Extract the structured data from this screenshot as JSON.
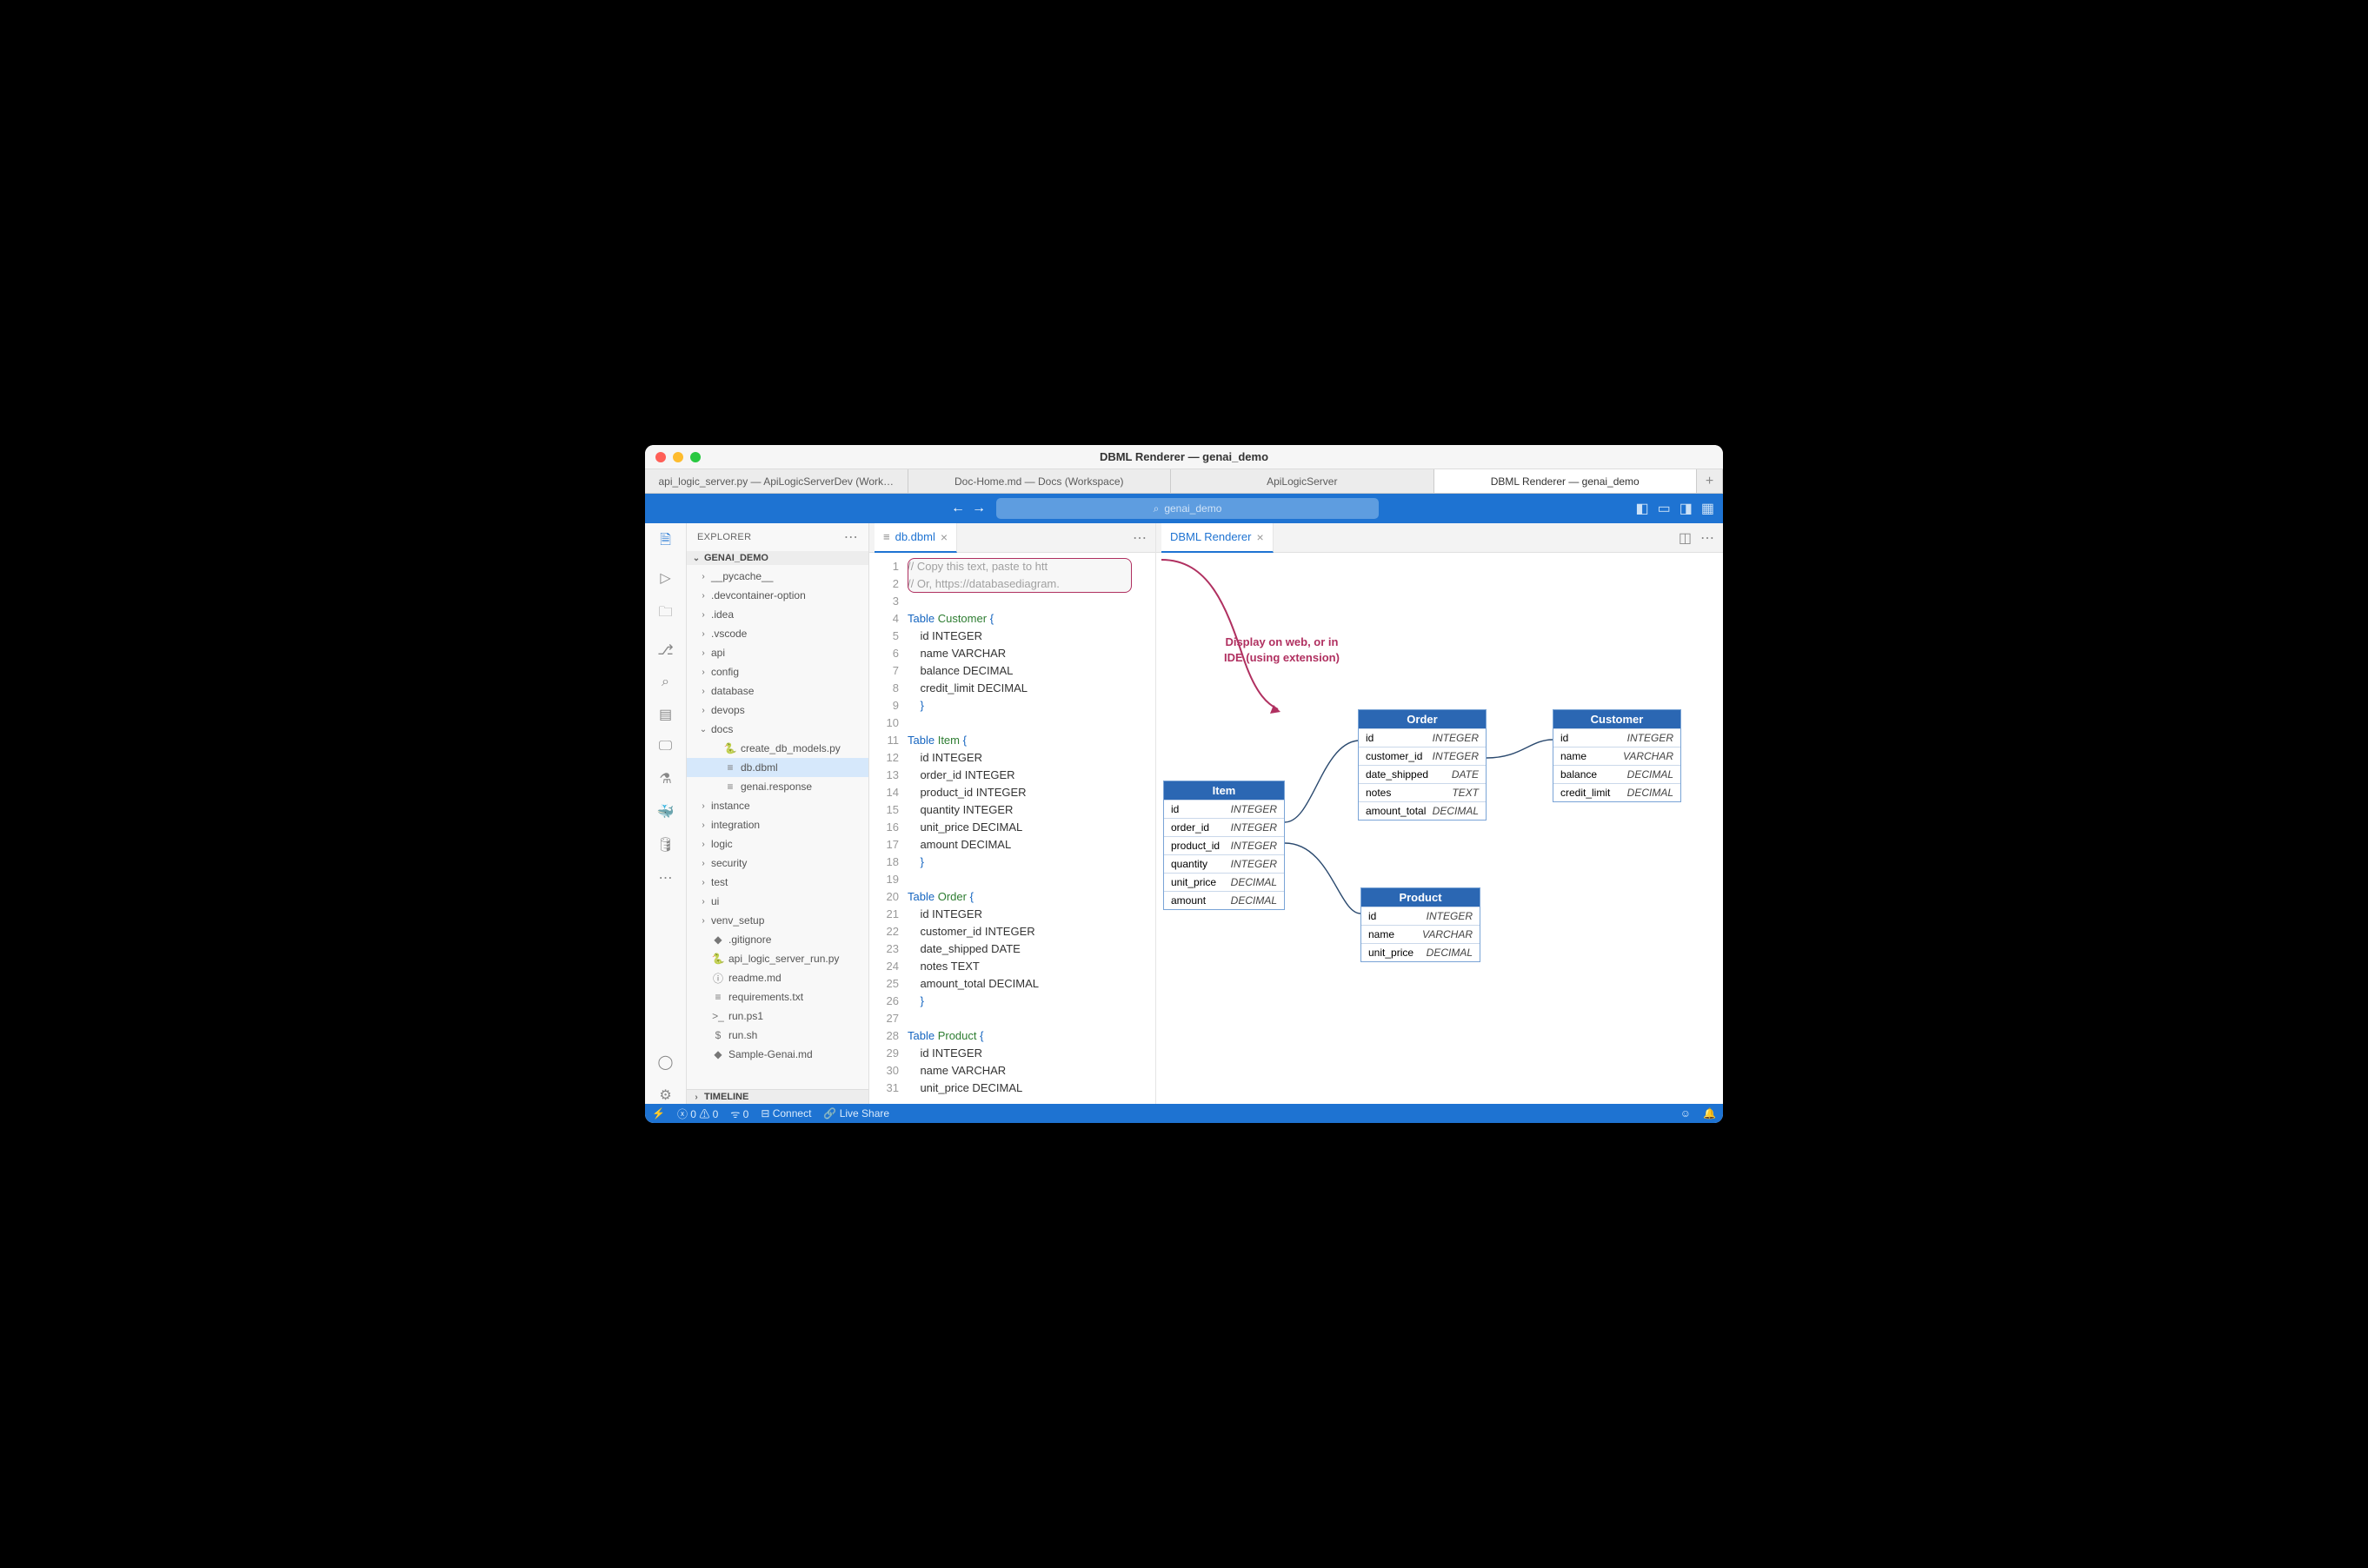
{
  "titlebar": {
    "title": "DBML Renderer — genai_demo"
  },
  "wintabs": [
    "api_logic_server.py — ApiLogicServerDev (Work…",
    "Doc-Home.md — Docs (Workspace)",
    "ApiLogicServer",
    "DBML Renderer — genai_demo"
  ],
  "search": {
    "placeholder": "genai_demo"
  },
  "sidebar": {
    "title": "EXPLORER",
    "project": "GENAI_DEMO",
    "tree": [
      {
        "d": 1,
        "exp": false,
        "label": "__pycache__",
        "kind": "folder"
      },
      {
        "d": 1,
        "exp": false,
        "label": ".devcontainer-option",
        "kind": "folder"
      },
      {
        "d": 1,
        "exp": false,
        "label": ".idea",
        "kind": "folder"
      },
      {
        "d": 1,
        "exp": false,
        "label": ".vscode",
        "kind": "folder"
      },
      {
        "d": 1,
        "exp": false,
        "label": "api",
        "kind": "folder"
      },
      {
        "d": 1,
        "exp": false,
        "label": "config",
        "kind": "folder"
      },
      {
        "d": 1,
        "exp": false,
        "label": "database",
        "kind": "folder"
      },
      {
        "d": 1,
        "exp": false,
        "label": "devops",
        "kind": "folder"
      },
      {
        "d": 1,
        "exp": true,
        "label": "docs",
        "kind": "folder"
      },
      {
        "d": 2,
        "label": "create_db_models.py",
        "kind": "py"
      },
      {
        "d": 2,
        "label": "db.dbml",
        "kind": "file",
        "selected": true
      },
      {
        "d": 2,
        "label": "genai.response",
        "kind": "file"
      },
      {
        "d": 1,
        "exp": false,
        "label": "instance",
        "kind": "folder"
      },
      {
        "d": 1,
        "exp": false,
        "label": "integration",
        "kind": "folder"
      },
      {
        "d": 1,
        "exp": false,
        "label": "logic",
        "kind": "folder"
      },
      {
        "d": 1,
        "exp": false,
        "label": "security",
        "kind": "folder"
      },
      {
        "d": 1,
        "exp": false,
        "label": "test",
        "kind": "folder"
      },
      {
        "d": 1,
        "exp": false,
        "label": "ui",
        "kind": "folder"
      },
      {
        "d": 1,
        "exp": false,
        "label": "venv_setup",
        "kind": "folder"
      },
      {
        "d": 1,
        "label": ".gitignore",
        "kind": "git"
      },
      {
        "d": 1,
        "label": "api_logic_server_run.py",
        "kind": "py"
      },
      {
        "d": 1,
        "label": "readme.md",
        "kind": "info"
      },
      {
        "d": 1,
        "label": "requirements.txt",
        "kind": "file"
      },
      {
        "d": 1,
        "label": "run.ps1",
        "kind": "ps"
      },
      {
        "d": 1,
        "label": "run.sh",
        "kind": "sh"
      },
      {
        "d": 1,
        "label": "Sample-Genai.md",
        "kind": "md"
      }
    ],
    "timeline": "TIMELINE"
  },
  "editor": {
    "tab": "db.dbml",
    "lines": [
      {
        "t": "comment",
        "s": "// Copy this text, paste to htt"
      },
      {
        "t": "comment",
        "s": "// Or, https://databasediagram."
      },
      {
        "t": "",
        "s": ""
      },
      {
        "t": "decl",
        "kw": "Table",
        "name": "Customer",
        "brace": "{"
      },
      {
        "t": "field",
        "s": "    id INTEGER"
      },
      {
        "t": "field",
        "s": "    name VARCHAR"
      },
      {
        "t": "field",
        "s": "    balance DECIMAL"
      },
      {
        "t": "field",
        "s": "    credit_limit DECIMAL"
      },
      {
        "t": "brace",
        "s": "    }"
      },
      {
        "t": "",
        "s": ""
      },
      {
        "t": "decl",
        "kw": "Table",
        "name": "Item",
        "brace": "{"
      },
      {
        "t": "field",
        "s": "    id INTEGER"
      },
      {
        "t": "field",
        "s": "    order_id INTEGER"
      },
      {
        "t": "field",
        "s": "    product_id INTEGER"
      },
      {
        "t": "field",
        "s": "    quantity INTEGER"
      },
      {
        "t": "field",
        "s": "    unit_price DECIMAL"
      },
      {
        "t": "field",
        "s": "    amount DECIMAL"
      },
      {
        "t": "brace",
        "s": "    }"
      },
      {
        "t": "",
        "s": ""
      },
      {
        "t": "decl",
        "kw": "Table",
        "name": "Order",
        "brace": "{"
      },
      {
        "t": "field",
        "s": "    id INTEGER"
      },
      {
        "t": "field",
        "s": "    customer_id INTEGER"
      },
      {
        "t": "field",
        "s": "    date_shipped DATE"
      },
      {
        "t": "field",
        "s": "    notes TEXT"
      },
      {
        "t": "field",
        "s": "    amount_total DECIMAL"
      },
      {
        "t": "brace",
        "s": "    }"
      },
      {
        "t": "",
        "s": ""
      },
      {
        "t": "decl",
        "kw": "Table",
        "name": "Product",
        "brace": "{"
      },
      {
        "t": "field",
        "s": "    id INTEGER"
      },
      {
        "t": "field",
        "s": "    name VARCHAR"
      },
      {
        "t": "field",
        "s": "    unit_price DECIMAL"
      }
    ]
  },
  "renderer": {
    "tab": "DBML Renderer",
    "note_l1": "Display on web, or in",
    "note_l2": "IDE (using extension)",
    "entities": {
      "item": {
        "title": "Item",
        "cols": [
          [
            "id",
            "INTEGER"
          ],
          [
            "order_id",
            "INTEGER"
          ],
          [
            "product_id",
            "INTEGER"
          ],
          [
            "quantity",
            "INTEGER"
          ],
          [
            "unit_price",
            "DECIMAL"
          ],
          [
            "amount",
            "DECIMAL"
          ]
        ]
      },
      "order": {
        "title": "Order",
        "cols": [
          [
            "id",
            "INTEGER"
          ],
          [
            "customer_id",
            "INTEGER"
          ],
          [
            "date_shipped",
            "DATE"
          ],
          [
            "notes",
            "TEXT"
          ],
          [
            "amount_total",
            "DECIMAL"
          ]
        ]
      },
      "customer": {
        "title": "Customer",
        "cols": [
          [
            "id",
            "INTEGER"
          ],
          [
            "name",
            "VARCHAR"
          ],
          [
            "balance",
            "DECIMAL"
          ],
          [
            "credit_limit",
            "DECIMAL"
          ]
        ]
      },
      "product": {
        "title": "Product",
        "cols": [
          [
            "id",
            "INTEGER"
          ],
          [
            "name",
            "VARCHAR"
          ],
          [
            "unit_price",
            "DECIMAL"
          ]
        ]
      }
    }
  },
  "status": {
    "remote": "⎇",
    "errors": "0",
    "warnings": "0",
    "ports": "0",
    "connect": "Connect",
    "live": "Live Share"
  }
}
